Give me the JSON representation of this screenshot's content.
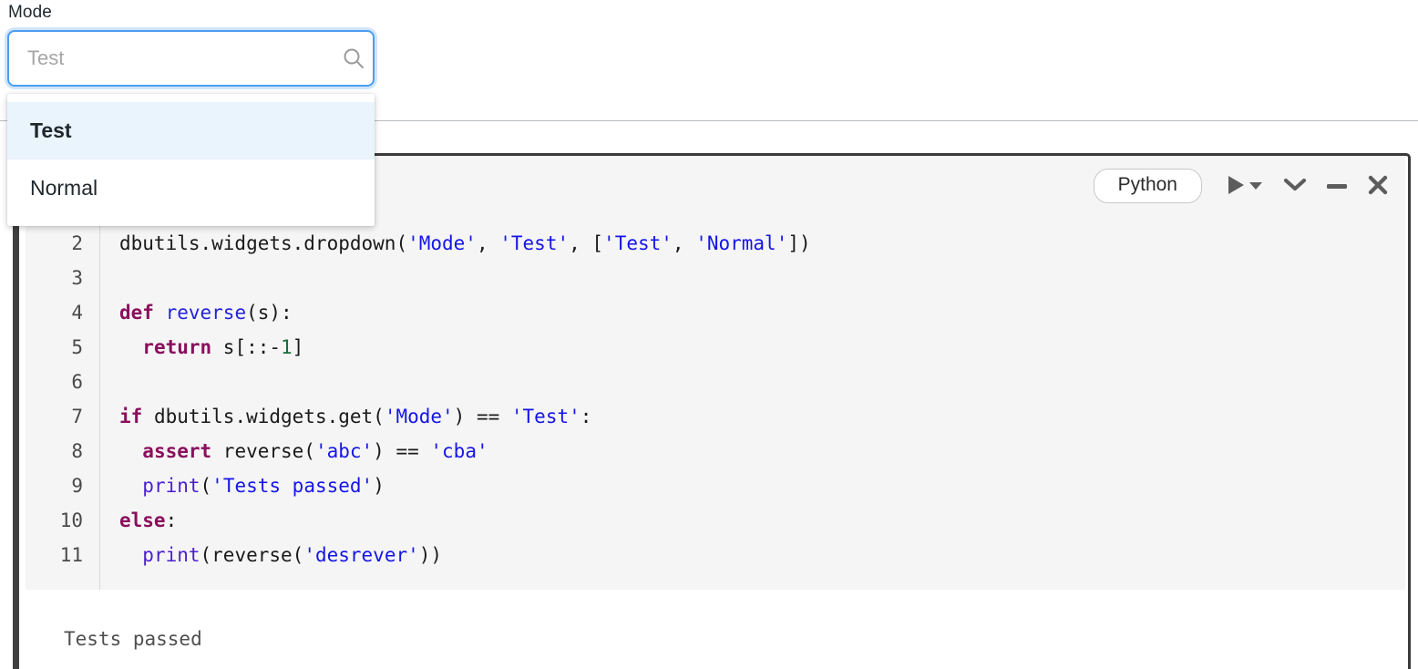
{
  "widget": {
    "label": "Mode",
    "input_value": "",
    "placeholder": "Test",
    "search_icon": "search-icon",
    "options": [
      {
        "label": "Test",
        "selected": true
      },
      {
        "label": "Normal",
        "selected": false
      }
    ]
  },
  "cell": {
    "toolbar": {
      "language": "Python",
      "run_icon": "play-icon",
      "run_caret_icon": "caret-down-icon",
      "collapse_icon": "chevron-down-icon",
      "minimize_icon": "minus-icon",
      "close_icon": "close-icon"
    },
    "gutter": [
      "2",
      "3",
      "4",
      "5",
      "6",
      "7",
      "8",
      "9",
      "10",
      "11"
    ],
    "code_lines": [
      [
        {
          "t": "dbutils.widgets.dropdown",
          "c": "pl"
        },
        {
          "t": "(",
          "c": "pl"
        },
        {
          "t": "'Mode'",
          "c": "str"
        },
        {
          "t": ", ",
          "c": "pl"
        },
        {
          "t": "'Test'",
          "c": "str"
        },
        {
          "t": ", [",
          "c": "pl"
        },
        {
          "t": "'Test'",
          "c": "str"
        },
        {
          "t": ", ",
          "c": "pl"
        },
        {
          "t": "'Normal'",
          "c": "str"
        },
        {
          "t": "])",
          "c": "pl"
        }
      ],
      [],
      [
        {
          "t": "def",
          "c": "kw"
        },
        {
          "t": " ",
          "c": "pl"
        },
        {
          "t": "reverse",
          "c": "fn"
        },
        {
          "t": "(s):",
          "c": "pl"
        }
      ],
      [
        {
          "t": "  ",
          "c": "pl"
        },
        {
          "t": "return",
          "c": "kw"
        },
        {
          "t": " s[::-",
          "c": "pl"
        },
        {
          "t": "1",
          "c": "num"
        },
        {
          "t": "]",
          "c": "pl"
        }
      ],
      [],
      [
        {
          "t": "if",
          "c": "kw"
        },
        {
          "t": " dbutils.widgets.get(",
          "c": "pl"
        },
        {
          "t": "'Mode'",
          "c": "str"
        },
        {
          "t": ") == ",
          "c": "pl"
        },
        {
          "t": "'Test'",
          "c": "str"
        },
        {
          "t": ":",
          "c": "pl"
        }
      ],
      [
        {
          "t": "  ",
          "c": "pl"
        },
        {
          "t": "assert",
          "c": "kw"
        },
        {
          "t": " reverse(",
          "c": "pl"
        },
        {
          "t": "'abc'",
          "c": "str"
        },
        {
          "t": ") == ",
          "c": "pl"
        },
        {
          "t": "'cba'",
          "c": "str"
        }
      ],
      [
        {
          "t": "  ",
          "c": "pl"
        },
        {
          "t": "print",
          "c": "bi"
        },
        {
          "t": "(",
          "c": "pl"
        },
        {
          "t": "'Tests passed'",
          "c": "str"
        },
        {
          "t": ")",
          "c": "pl"
        }
      ],
      [
        {
          "t": "else",
          "c": "kw"
        },
        {
          "t": ":",
          "c": "pl"
        }
      ],
      [
        {
          "t": "  ",
          "c": "pl"
        },
        {
          "t": "print",
          "c": "bi"
        },
        {
          "t": "(reverse(",
          "c": "pl"
        },
        {
          "t": "'desrever'",
          "c": "str"
        },
        {
          "t": "))",
          "c": "pl"
        }
      ]
    ],
    "output": "Tests passed"
  },
  "colors": {
    "focus_border": "#4a9ef0",
    "option_highlight": "#eaf4fd",
    "cell_accent": "#3f3f3f",
    "code_bg": "#f5f5f5",
    "keyword": "#8a0f5c",
    "string": "#1515e8",
    "function": "#2323dc",
    "number": "#1a6b3c",
    "builtin": "#4a1fd0"
  }
}
